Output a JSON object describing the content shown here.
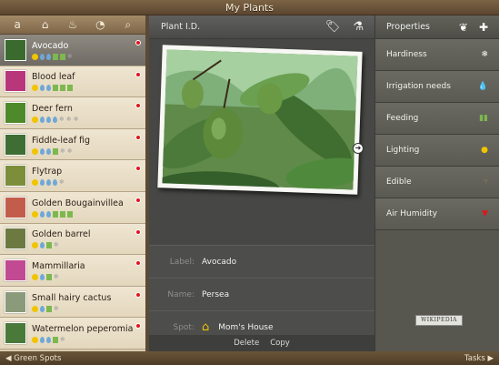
{
  "app": {
    "title": "My Plants"
  },
  "left_toolbar": {
    "icons": [
      {
        "name": "alphabetical-sort-icon",
        "glyph": "a"
      },
      {
        "name": "house-icon",
        "glyph": "⌂"
      },
      {
        "name": "watering-can-icon",
        "glyph": "♨"
      },
      {
        "name": "clock-icon",
        "glyph": "◔"
      },
      {
        "name": "search-icon",
        "glyph": "⌕"
      }
    ]
  },
  "plants": [
    {
      "name": "Avocado",
      "thumb": "#3a6a2e",
      "badges": [
        "sun",
        "drop",
        "drop",
        "leaf",
        "leaf",
        "flake"
      ],
      "selected": true
    },
    {
      "name": "Blood leaf",
      "thumb": "#b8367a",
      "badges": [
        "sun",
        "drop",
        "drop",
        "leaf",
        "leaf",
        "leaf"
      ]
    },
    {
      "name": "Deer fern",
      "thumb": "#4f8a2a",
      "badges": [
        "sun",
        "drop",
        "drop",
        "drop",
        "flake",
        "flake",
        "flake"
      ]
    },
    {
      "name": "Fiddle-leaf fig",
      "thumb": "#3f6e34",
      "badges": [
        "sun",
        "drop",
        "drop",
        "leaf",
        "flake",
        "flake"
      ]
    },
    {
      "name": "Flytrap",
      "thumb": "#7c8e3a",
      "badges": [
        "sun",
        "drop",
        "drop",
        "drop",
        "flake"
      ]
    },
    {
      "name": "Golden Bougainvillea",
      "thumb": "#c35d4b",
      "badges": [
        "sun",
        "drop",
        "drop",
        "leaf",
        "leaf",
        "leaf"
      ]
    },
    {
      "name": "Golden barrel",
      "thumb": "#6c7a42",
      "badges": [
        "sun",
        "drop",
        "leaf",
        "flake"
      ]
    },
    {
      "name": "Mammillaria",
      "thumb": "#c24a92",
      "badges": [
        "sun",
        "drop",
        "leaf",
        "flake"
      ]
    },
    {
      "name": "Small hairy cactus",
      "thumb": "#8a9a7a",
      "badges": [
        "sun",
        "drop",
        "leaf",
        "flake"
      ]
    },
    {
      "name": "Watermelon peperomia",
      "thumb": "#4a7a3a",
      "badges": [
        "sun",
        "drop",
        "drop",
        "leaf",
        "flake"
      ]
    }
  ],
  "middle": {
    "title": "Plant I.D.",
    "fields": {
      "label_label": "Label:",
      "label_value": "Avocado",
      "name_label": "Name:",
      "name_value": "Persea",
      "spot_label": "Spot:",
      "spot_value": "Mom's House"
    },
    "footer": {
      "delete": "Delete",
      "copy": "Copy"
    }
  },
  "right": {
    "title": "Properties",
    "properties": [
      {
        "label": "Hardiness",
        "icon": "❄",
        "color": "#ffffff"
      },
      {
        "label": "Irrigation needs",
        "icon": "💧",
        "color": "#7fb4e6"
      },
      {
        "label": "Feeding",
        "icon": "▮▮",
        "color": "#7db84e"
      },
      {
        "label": "Lighting",
        "icon": "●",
        "color": "#f0c400"
      },
      {
        "label": "Edible",
        "icon": "⑂",
        "color": "#9a7d4f"
      },
      {
        "label": "Air Humidity",
        "icon": "▼",
        "color": "#e0141c"
      }
    ],
    "wiki": "WIKIPEDIA"
  },
  "bottombar": {
    "left": "◀ Green Spots",
    "right": "Tasks ▶"
  }
}
